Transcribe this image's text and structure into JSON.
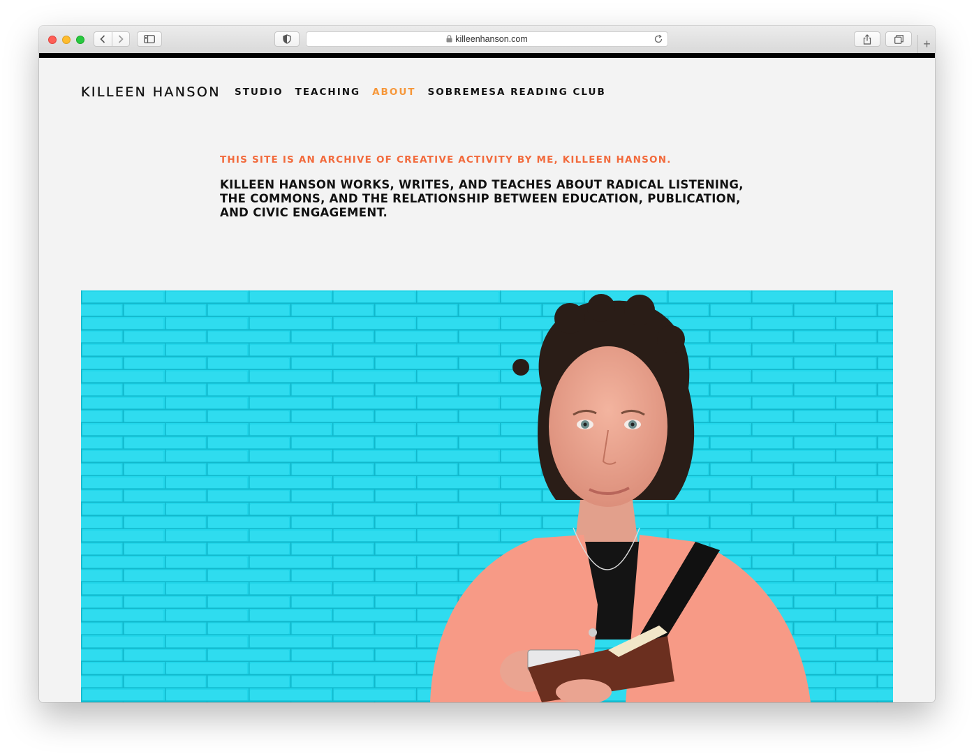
{
  "browser": {
    "url": "killeenhanson.com",
    "new_tab_symbol": "+"
  },
  "site": {
    "title": "KILLEEN HANSON",
    "nav": [
      {
        "label": "STUDIO",
        "active": false
      },
      {
        "label": "TEACHING",
        "active": false
      },
      {
        "label": "ABOUT",
        "active": true
      },
      {
        "label": "SOBREMESA READING CLUB",
        "active": false
      }
    ]
  },
  "about": {
    "intro": "THIS SITE IS AN ARCHIVE OF CREATIVE ACTIVITY BY ME, KILLEEN HANSON.",
    "bio": "KILLEEN HANSON WORKS, WRITES, AND TEACHES ABOUT RADICAL LISTENING, THE COMMONS, AND THE RELATIONSHIP BETWEEN EDUCATION, PUBLICATION, AND CIVIC ENGAGEMENT."
  },
  "colors": {
    "active_nav": "#f6973a",
    "intro_text": "#f26a3c",
    "wall": "#22d6ea",
    "page_bg": "#f3f3f3"
  }
}
